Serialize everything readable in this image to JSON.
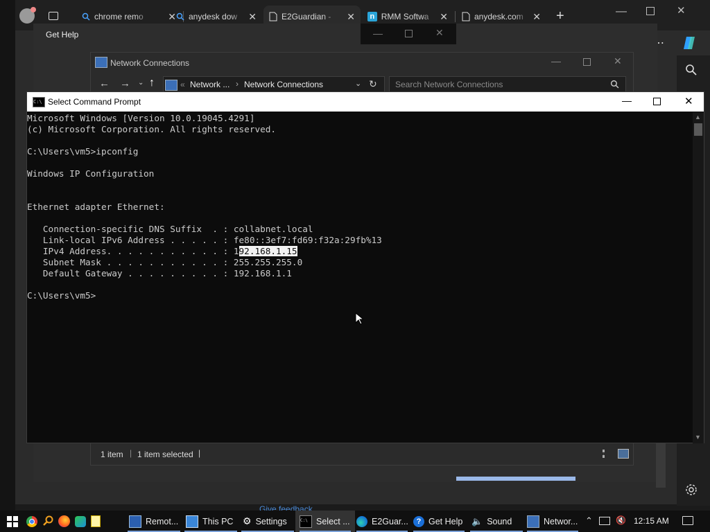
{
  "edge": {
    "tabs": [
      {
        "label": "chrome remo",
        "icon": "search-icon"
      },
      {
        "label": "anydesk dow",
        "icon": "search-icon"
      },
      {
        "label": "E2Guardian -",
        "icon": "page-icon"
      },
      {
        "label": "RMM Softwa",
        "icon": "n-site-icon"
      },
      {
        "label": "anydesk.com",
        "icon": "page-icon"
      }
    ],
    "active_tab_index": 2,
    "new_tab": "+",
    "bottom_link": "Give feedback"
  },
  "get_help": {
    "title": "Get Help"
  },
  "network_connections": {
    "title": "Network Connections",
    "breadcrumb": [
      "Network ...",
      "Network Connections"
    ],
    "breadcrumb_prefix": "«",
    "search_placeholder": "Search Network Connections",
    "status_items": "1 item",
    "status_selected": "1 item selected"
  },
  "cmd": {
    "title": "Select Command Prompt",
    "lines": [
      "Microsoft Windows [Version 10.0.19045.4291]",
      "(c) Microsoft Corporation. All rights reserved.",
      "",
      "C:\\Users\\vm5>ipconfig",
      "",
      "Windows IP Configuration",
      "",
      "",
      "Ethernet adapter Ethernet:",
      "",
      "   Connection-specific DNS Suffix  . : collabnet.local",
      "   Link-local IPv6 Address . . . . . : fe80::3ef7:fd69:f32a:29fb%13",
      "",
      "   Subnet Mask . . . . . . . . . . . : 255.255.255.0",
      "   Default Gateway . . . . . . . . . : 192.168.1.1",
      "",
      "C:\\Users\\vm5>"
    ],
    "ipv4_prefix": "   IPv4 Address. . . . . . . . . . . : 1",
    "ipv4_selected": "92.168.1.15"
  },
  "taskbar": {
    "items": [
      {
        "label": "Remot...",
        "icon": "remote-desktop-icon"
      },
      {
        "label": "This PC",
        "icon": "computer-icon"
      },
      {
        "label": "Settings",
        "icon": "gear-icon"
      },
      {
        "label": "Select ...",
        "icon": "cmd-icon"
      },
      {
        "label": "E2Guar...",
        "icon": "edge-icon"
      },
      {
        "label": "Get Help",
        "icon": "help-icon"
      },
      {
        "label": "Sound",
        "icon": "speaker-icon"
      },
      {
        "label": "Networ...",
        "icon": "network-icon"
      }
    ],
    "clock": "12:15 AM"
  }
}
